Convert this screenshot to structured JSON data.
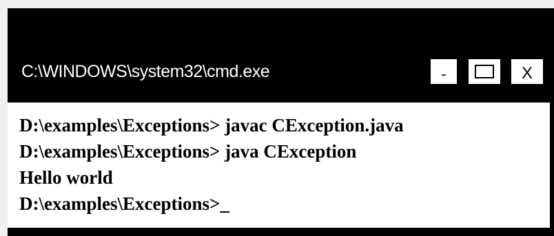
{
  "window": {
    "title": "C:\\WINDOWS\\system32\\cmd.exe",
    "controls": {
      "minimize_label": "-",
      "close_label": "X"
    }
  },
  "console": {
    "lines": [
      "D:\\examples\\Exceptions> javac CException.java",
      "D:\\examples\\Exceptions> java CException",
      "Hello world",
      "D:\\examples\\Exceptions>_"
    ]
  },
  "colors": {
    "window_background": "#000000",
    "console_background": "#ffffff",
    "title_text": "#ffffff",
    "console_text": "#000000"
  }
}
